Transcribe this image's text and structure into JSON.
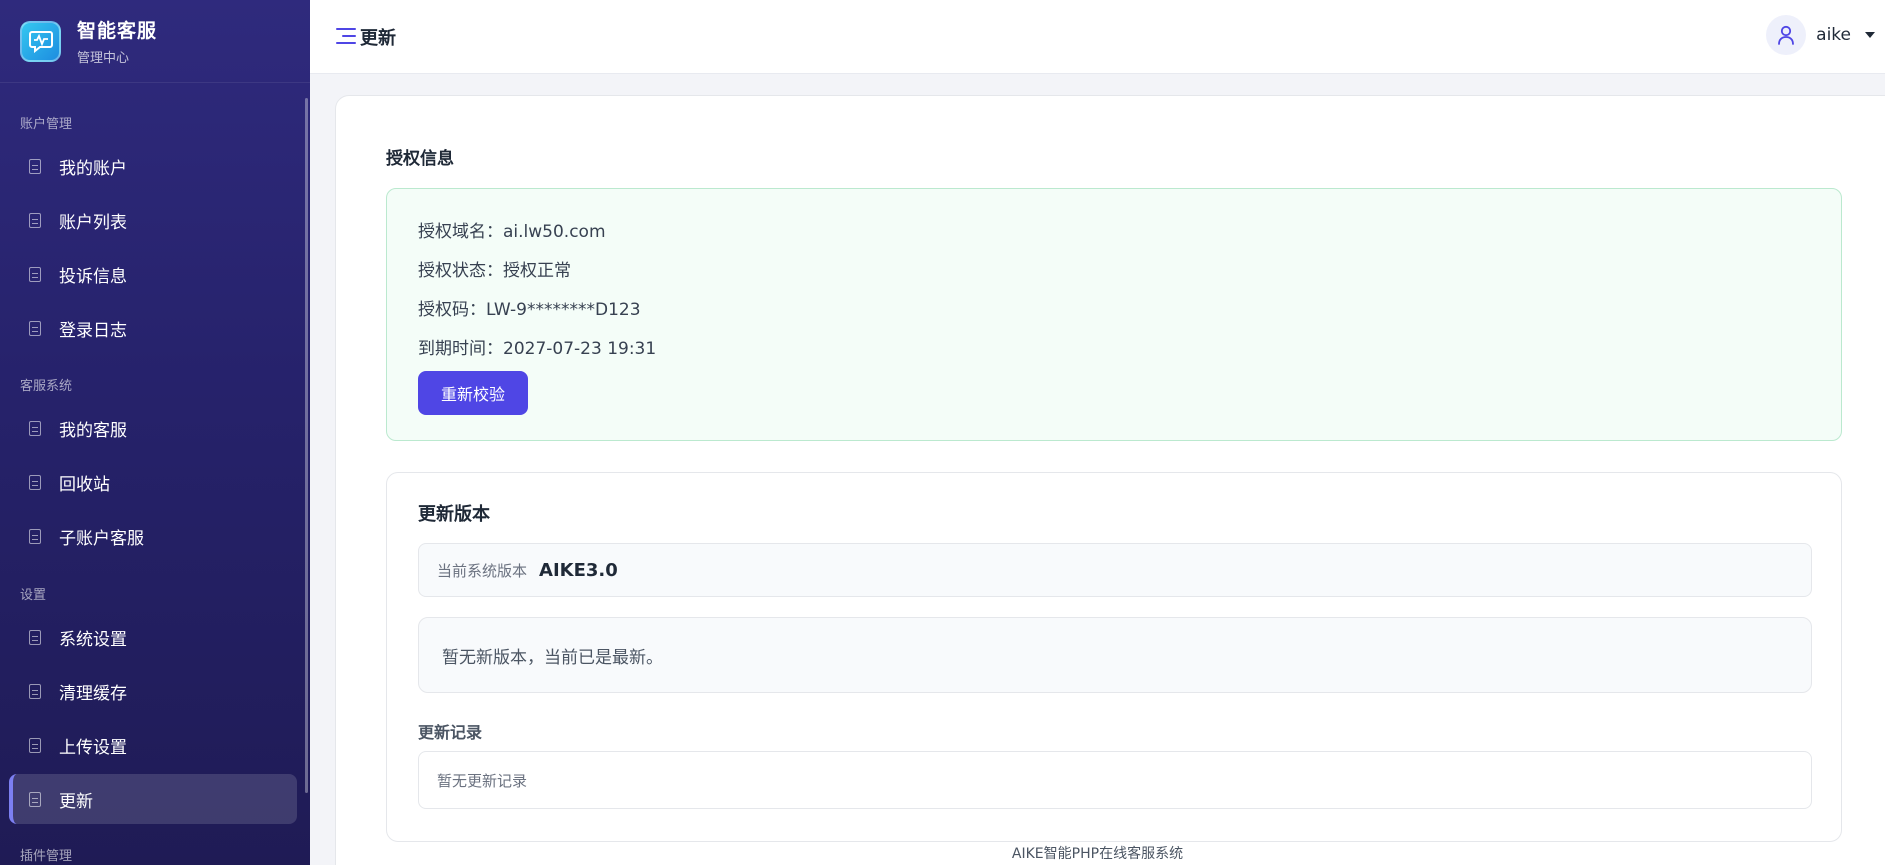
{
  "brand": {
    "title": "智能客服",
    "subtitle": "管理中心"
  },
  "sidebar": {
    "sections": [
      {
        "label": "账户管理",
        "items": [
          "我的账户",
          "账户列表",
          "投诉信息",
          "登录日志"
        ]
      },
      {
        "label": "客服系统",
        "items": [
          "我的客服",
          "回收站",
          "子账户客服"
        ]
      },
      {
        "label": "设置",
        "items": [
          "系统设置",
          "清理缓存",
          "上传设置",
          "更新"
        ]
      },
      {
        "label": "插件管理",
        "items": []
      }
    ],
    "active_item": "更新"
  },
  "header": {
    "title": "更新",
    "user_name": "aike"
  },
  "license": {
    "title": "授权信息",
    "domain_label": "授权域名：",
    "domain": "ai.lw50.com",
    "status_label": "授权状态：",
    "status": "授权正常",
    "code_label": "授权码：",
    "code": "LW-9********D123",
    "expire_label": "到期时间：",
    "expire": "2027-07-23 19:31",
    "recheck_button": "重新校验"
  },
  "update": {
    "title": "更新版本",
    "current_version_label": "当前系统版本",
    "current_version": "AIKE3.0",
    "notice": "暂无新版本，当前已是最新。",
    "log_title": "更新记录",
    "log_empty": "暂无更新记录"
  },
  "footer": {
    "text": "AIKE智能PHP在线客服系统"
  },
  "colors": {
    "primary": "#4f46e5",
    "sidebar": "#2f2a7d",
    "license_bg": "#f4fdf8"
  },
  "icons": [
    "brand-logo-icon",
    "document-icon",
    "menu-icon",
    "user-icon",
    "caret-down-icon"
  ]
}
